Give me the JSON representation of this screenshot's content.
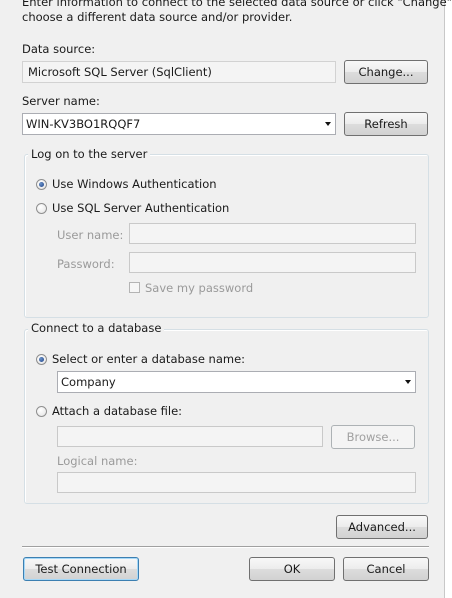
{
  "intro": {
    "line1": "Enter information to connect to the selected data source or click \"Change\" to",
    "line2": "choose a different data source and/or provider."
  },
  "data_source": {
    "label": "Data source:",
    "value": "Microsoft SQL Server (SqlClient)",
    "change_button": "Change..."
  },
  "server": {
    "label": "Server name:",
    "value": "WIN-KV3BO1RQQF7",
    "refresh_button": "Refresh"
  },
  "logon": {
    "legend": "Log on to the server",
    "windows_auth": "Use Windows Authentication",
    "sql_auth": "Use SQL Server Authentication",
    "selected": "windows_auth",
    "username_label": "User name:",
    "username_value": "",
    "password_label": "Password:",
    "password_value": "",
    "save_password": "Save my password",
    "save_password_checked": false
  },
  "database": {
    "legend": "Connect to a database",
    "select_option": "Select or enter a database name:",
    "selected": "select_option",
    "database_value": "Company",
    "attach_option": "Attach a database file:",
    "attach_value": "",
    "browse_button": "Browse...",
    "logical_label": "Logical name:",
    "logical_value": ""
  },
  "footer": {
    "advanced_button": "Advanced...",
    "test_button": "Test Connection",
    "ok_button": "OK",
    "cancel_button": "Cancel"
  }
}
